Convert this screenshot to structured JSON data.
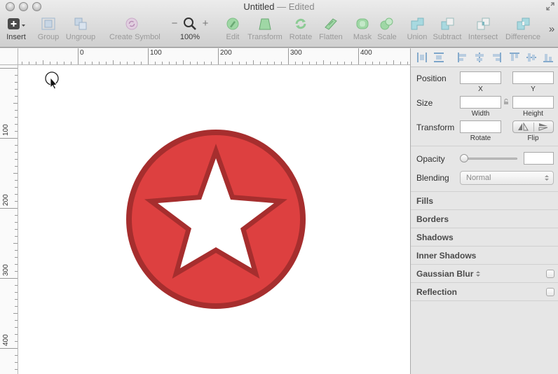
{
  "window": {
    "title": "Untitled",
    "status": "— Edited"
  },
  "toolbar": {
    "insert": "Insert",
    "group": "Group",
    "ungroup": "Ungroup",
    "create_symbol": "Create Symbol",
    "zoom_minus": "−",
    "zoom_plus": "+",
    "zoom_level": "100%",
    "edit": "Edit",
    "transform": "Transform",
    "rotate": "Rotate",
    "flatten": "Flatten",
    "mask": "Mask",
    "scale": "Scale",
    "union": "Union",
    "subtract": "Subtract",
    "intersect": "Intersect",
    "difference": "Difference",
    "overflow": "»"
  },
  "rulers": {
    "horizontal": [
      "0",
      "100",
      "200",
      "300",
      "400"
    ],
    "vertical": [
      "100",
      "200",
      "300",
      "400"
    ]
  },
  "canvas": {
    "shape": "star-in-circle",
    "circle_fill": "#dd4040",
    "circle_stroke": "#a62e2e",
    "star_fill": "#ffffff"
  },
  "inspector": {
    "position_label": "Position",
    "x_label": "X",
    "y_label": "Y",
    "size_label": "Size",
    "width_label": "Width",
    "height_label": "Height",
    "transform_label": "Transform",
    "rotate_label": "Rotate",
    "flip_label": "Flip",
    "opacity_label": "Opacity",
    "blending_label": "Blending",
    "blending_value": "Normal",
    "sections": [
      "Fills",
      "Borders",
      "Shadows",
      "Inner Shadows",
      "Gaussian Blur",
      "Reflection"
    ]
  },
  "colors": {
    "accent": "#dd4040",
    "disabled_icon": "#8fcf9a"
  }
}
